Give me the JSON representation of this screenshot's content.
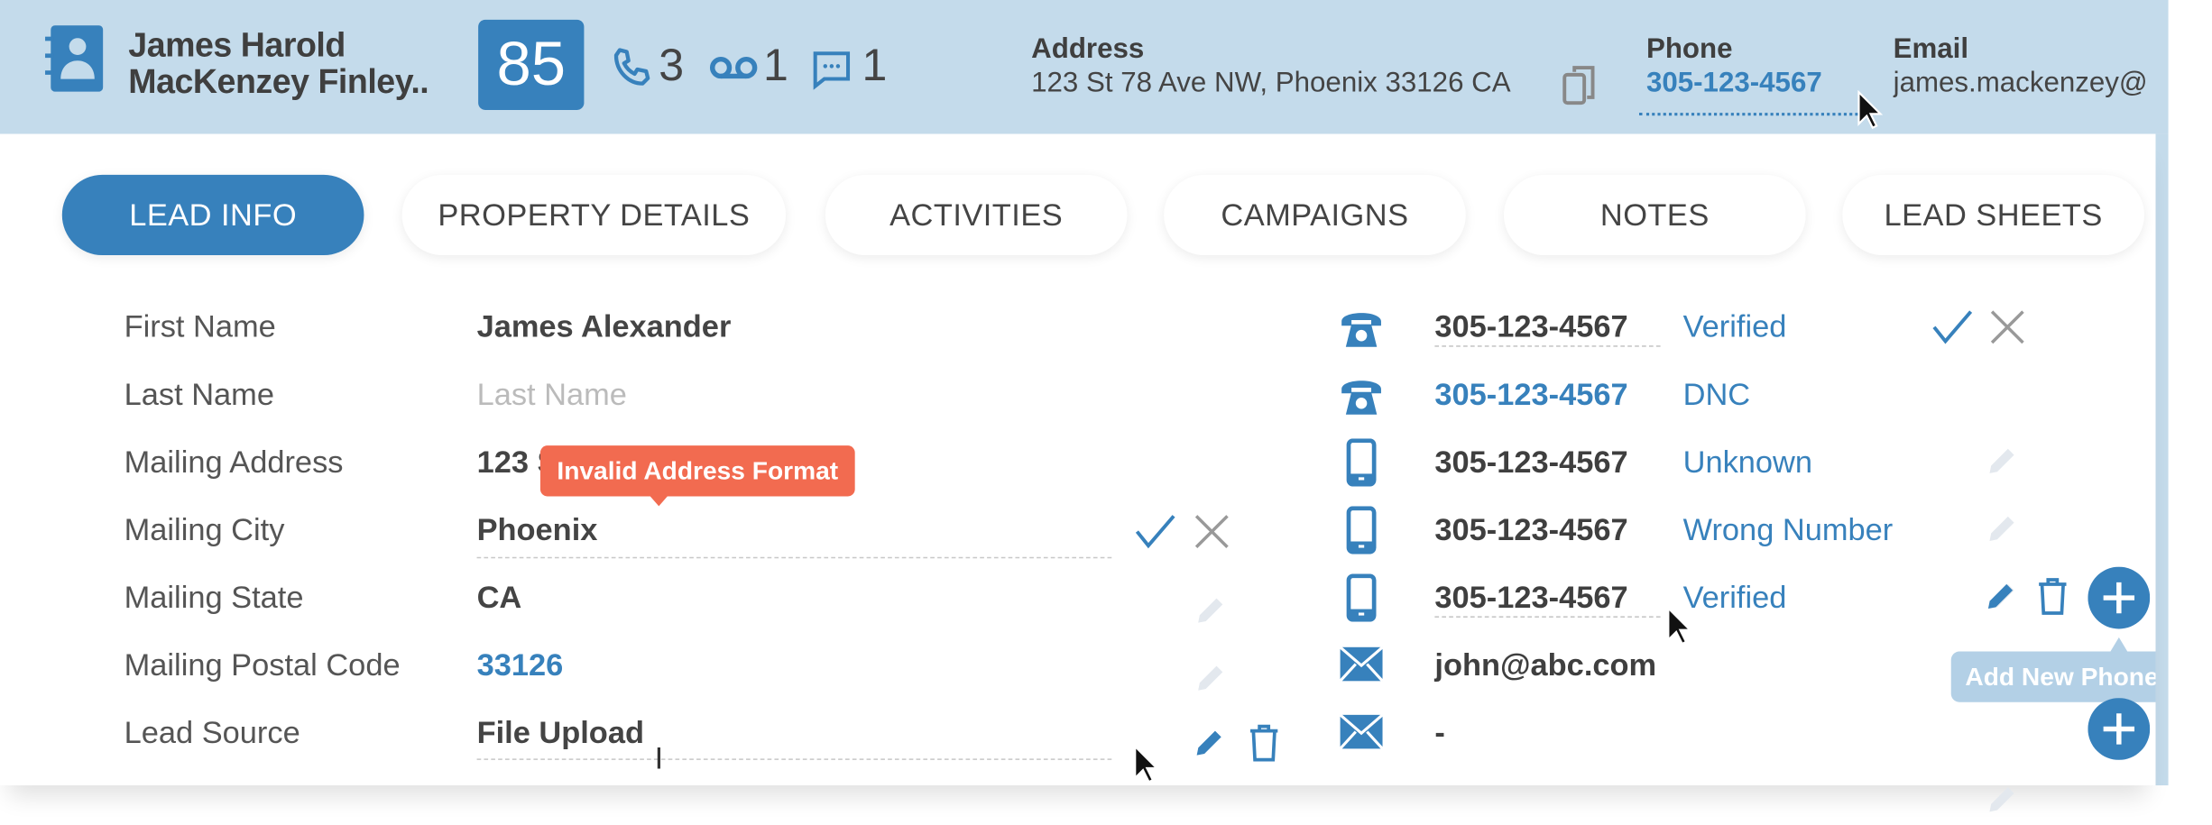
{
  "header": {
    "name_line1": "James Harold",
    "name_line2": "MacKenzey Finley..",
    "score": "85",
    "call_count": "3",
    "voicemail_count": "1",
    "message_count": "1",
    "address_label": "Address",
    "address_value": "123 St 78 Ave NW, Phoenix 33126 CA",
    "phone_label": "Phone",
    "phone_value": "305-123-4567",
    "email_label": "Email",
    "email_value": "james.mackenzey@"
  },
  "tabs": [
    {
      "label": "LEAD INFO",
      "active": true
    },
    {
      "label": "PROPERTY DETAILS"
    },
    {
      "label": "ACTIVITIES"
    },
    {
      "label": "CAMPAIGNS"
    },
    {
      "label": "NOTES"
    },
    {
      "label": "LEAD SHEETS"
    }
  ],
  "fields": [
    {
      "label": "First Name",
      "value": "James Alexander"
    },
    {
      "label": "Last Name",
      "placeholder": "Last Name"
    },
    {
      "label": "Mailing Address",
      "value": "123 S"
    },
    {
      "label": "Mailing City",
      "value": "Phoenix"
    },
    {
      "label": "Mailing State",
      "value": "CA"
    },
    {
      "label": "Mailing Postal Code",
      "value": "33126"
    },
    {
      "label": "Lead Source",
      "value": "File Upload"
    }
  ],
  "address_error_tooltip": "Invalid Address Format",
  "contacts": [
    {
      "type": "landline",
      "value": "305-123-4567",
      "status": "Verified"
    },
    {
      "type": "landline",
      "value": "305-123-4567",
      "status": "DNC"
    },
    {
      "type": "mobile",
      "value": "305-123-4567",
      "status": "Unknown"
    },
    {
      "type": "mobile",
      "value": "305-123-4567",
      "status": "Wrong Number"
    },
    {
      "type": "mobile",
      "value": "305-123-4567",
      "status": "Verified"
    },
    {
      "type": "email",
      "value": "john@abc.com"
    },
    {
      "type": "email",
      "value": "-"
    }
  ],
  "add_phone_tooltip": "Add New Phone N",
  "colors": {
    "accent": "#3781bc",
    "header_bg": "#c4dbeb",
    "error": "#f26b50",
    "tooltip_info": "#b3d0e6"
  }
}
